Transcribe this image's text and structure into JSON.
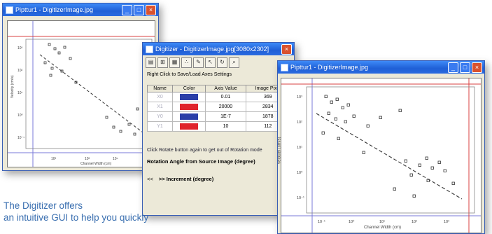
{
  "windows": {
    "left_plot": {
      "title": "Pipttur1 - DigitizerImage.jpg"
    },
    "digitizer": {
      "title": "Digitizer - DigitizerImage.jpg[3080x2302]",
      "hint": "Right Click to Save/Load Axes Settings",
      "columns": [
        "Name",
        "Color",
        "Axis Value",
        "Image Pixel"
      ],
      "rows": [
        {
          "name": "X0",
          "color": "blue",
          "axis_value": "0.01",
          "image_pixel": "369"
        },
        {
          "name": "X1",
          "color": "red",
          "axis_value": "20000",
          "image_pixel": "2834"
        },
        {
          "name": "Y0",
          "color": "blue",
          "axis_value": "1E-7",
          "image_pixel": "1878"
        },
        {
          "name": "Y1",
          "color": "red",
          "axis_value": "10",
          "image_pixel": "112"
        }
      ],
      "rotation_note": "Click Rotate button again to get out of Rotation mode",
      "rotation_label": "Rotation Angle from Source Image (degree)",
      "increment_arrows": "<<",
      "increment_label": ">> Increment (degree)"
    },
    "right_plot": {
      "title": "Pipttur1 - DigitizerImage.jpg",
      "ylabel": "Velocity (cm/s)",
      "xlabel": "Channel Width (cm)"
    }
  },
  "caption": {
    "line1": "The Digitizer offers",
    "line2": "an intuitive GUI to help you quickly"
  },
  "colors": {
    "blue": "#2a3ea8",
    "red": "#e0232c",
    "caption": "#3a6fb0"
  }
}
